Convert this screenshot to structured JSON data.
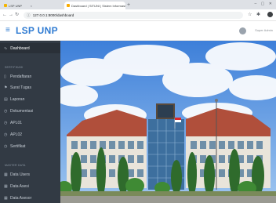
{
  "browser": {
    "tabs": [
      {
        "label": "LSP UNP",
        "active": false
      },
      {
        "label": "Dashboard | SITUNI | Sistem Informasi",
        "active": true
      }
    ],
    "address": "127.0.0.1:8000/dashboard",
    "new_tab": "+",
    "tab_close": "×"
  },
  "header": {
    "brand": "LSP UNP",
    "user_name": "Super Admin"
  },
  "sidebar": {
    "active_item": "Dashboard",
    "section_1": "SERTIFIKASI",
    "section_2": "MASTER DATA",
    "items": [
      {
        "label": "Pendaftaran",
        "icon": "document-icon"
      },
      {
        "label": "Surat Tugas",
        "icon": "flag-icon"
      },
      {
        "label": "Laporan",
        "icon": "clipboard-icon"
      },
      {
        "label": "Dokumentasi",
        "icon": "clock-icon"
      },
      {
        "label": "APL01",
        "icon": "clock-icon"
      },
      {
        "label": "APL02",
        "icon": "clock-icon"
      },
      {
        "label": "Sertifikat",
        "icon": "clock-icon"
      }
    ],
    "master_items": [
      {
        "label": "Data Users",
        "icon": "grid-icon"
      },
      {
        "label": "Data Asesi",
        "icon": "grid-icon"
      },
      {
        "label": "Data Asesor",
        "icon": "grid-icon"
      }
    ]
  },
  "colors": {
    "brand": "#2f7bd2",
    "sidebar_bg": "#323a44",
    "sidebar_active": "#2a3038"
  }
}
